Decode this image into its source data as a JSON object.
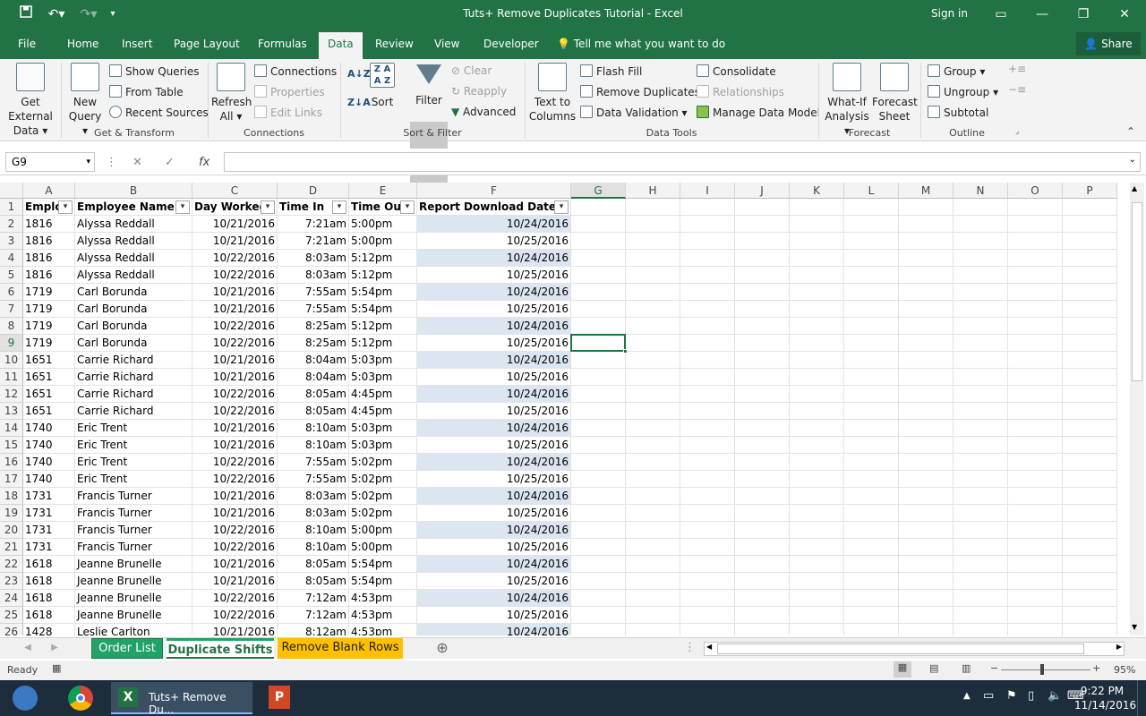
{
  "window": {
    "title": "Tuts+ Remove Duplicates Tutorial  -  Excel",
    "sign_in": "Sign in"
  },
  "tabs": [
    "File",
    "Home",
    "Insert",
    "Page Layout",
    "Formulas",
    "Data",
    "Review",
    "View",
    "Developer"
  ],
  "tell_me": "Tell me what you want to do",
  "share": "Share",
  "ribbon": {
    "get_external": [
      "Get External",
      "Data"
    ],
    "new_query": [
      "New",
      "Query"
    ],
    "show_queries": "Show Queries",
    "from_table": "From Table",
    "recent_sources": "Recent Sources",
    "group_get_transform": "Get & Transform",
    "refresh_all": [
      "Refresh",
      "All"
    ],
    "connections": "Connections",
    "properties": "Properties",
    "edit_links": "Edit Links",
    "group_connections": "Connections",
    "sort": "Sort",
    "filter": "Filter",
    "clear": "Clear",
    "reapply": "Reapply",
    "advanced": "Advanced",
    "group_sort_filter": "Sort & Filter",
    "text_to_columns": [
      "Text to",
      "Columns"
    ],
    "flash_fill": "Flash Fill",
    "remove_duplicates": "Remove Duplicates",
    "data_validation": "Data Validation",
    "consolidate": "Consolidate",
    "relationships": "Relationships",
    "manage_data_model": "Manage Data Model",
    "group_data_tools": "Data Tools",
    "what_if": [
      "What-If",
      "Analysis"
    ],
    "forecast_sheet": [
      "Forecast",
      "Sheet"
    ],
    "group_forecast": "Forecast",
    "group": "Group",
    "ungroup": "Ungroup",
    "subtotal": "Subtotal",
    "group_outline": "Outline"
  },
  "name_box": "G9",
  "columns": [
    "A",
    "B",
    "C",
    "D",
    "E",
    "F",
    "G",
    "H",
    "I",
    "J",
    "K",
    "L",
    "M",
    "N",
    "O",
    "P"
  ],
  "headers": [
    "Emplo",
    "Employee Name",
    "Day Worked",
    "Time In",
    "Time Out",
    "Report Download Date"
  ],
  "rows": [
    [
      "1816",
      "Alyssa Reddall",
      "10/21/2016",
      "7:21am",
      "5:00pm",
      "10/24/2016"
    ],
    [
      "1816",
      "Alyssa Reddall",
      "10/21/2016",
      "7:21am",
      "5:00pm",
      "10/25/2016"
    ],
    [
      "1816",
      "Alyssa Reddall",
      "10/22/2016",
      "8:03am",
      "5:12pm",
      "10/24/2016"
    ],
    [
      "1816",
      "Alyssa Reddall",
      "10/22/2016",
      "8:03am",
      "5:12pm",
      "10/25/2016"
    ],
    [
      "1719",
      "Carl Borunda",
      "10/21/2016",
      "7:55am",
      "5:54pm",
      "10/24/2016"
    ],
    [
      "1719",
      "Carl Borunda",
      "10/21/2016",
      "7:55am",
      "5:54pm",
      "10/25/2016"
    ],
    [
      "1719",
      "Carl Borunda",
      "10/22/2016",
      "8:25am",
      "5:12pm",
      "10/24/2016"
    ],
    [
      "1719",
      "Carl Borunda",
      "10/22/2016",
      "8:25am",
      "5:12pm",
      "10/25/2016"
    ],
    [
      "1651",
      "Carrie Richard",
      "10/21/2016",
      "8:04am",
      "5:03pm",
      "10/24/2016"
    ],
    [
      "1651",
      "Carrie Richard",
      "10/21/2016",
      "8:04am",
      "5:03pm",
      "10/25/2016"
    ],
    [
      "1651",
      "Carrie Richard",
      "10/22/2016",
      "8:05am",
      "4:45pm",
      "10/24/2016"
    ],
    [
      "1651",
      "Carrie Richard",
      "10/22/2016",
      "8:05am",
      "4:45pm",
      "10/25/2016"
    ],
    [
      "1740",
      "Eric Trent",
      "10/21/2016",
      "8:10am",
      "5:03pm",
      "10/24/2016"
    ],
    [
      "1740",
      "Eric Trent",
      "10/21/2016",
      "8:10am",
      "5:03pm",
      "10/25/2016"
    ],
    [
      "1740",
      "Eric Trent",
      "10/22/2016",
      "7:55am",
      "5:02pm",
      "10/24/2016"
    ],
    [
      "1740",
      "Eric Trent",
      "10/22/2016",
      "7:55am",
      "5:02pm",
      "10/25/2016"
    ],
    [
      "1731",
      "Francis Turner",
      "10/21/2016",
      "8:03am",
      "5:02pm",
      "10/24/2016"
    ],
    [
      "1731",
      "Francis Turner",
      "10/21/2016",
      "8:03am",
      "5:02pm",
      "10/25/2016"
    ],
    [
      "1731",
      "Francis Turner",
      "10/22/2016",
      "8:10am",
      "5:00pm",
      "10/24/2016"
    ],
    [
      "1731",
      "Francis Turner",
      "10/22/2016",
      "8:10am",
      "5:00pm",
      "10/25/2016"
    ],
    [
      "1618",
      "Jeanne Brunelle",
      "10/21/2016",
      "8:05am",
      "5:54pm",
      "10/24/2016"
    ],
    [
      "1618",
      "Jeanne Brunelle",
      "10/21/2016",
      "8:05am",
      "5:54pm",
      "10/25/2016"
    ],
    [
      "1618",
      "Jeanne Brunelle",
      "10/22/2016",
      "7:12am",
      "4:53pm",
      "10/24/2016"
    ],
    [
      "1618",
      "Jeanne Brunelle",
      "10/22/2016",
      "7:12am",
      "4:53pm",
      "10/25/2016"
    ],
    [
      "1428",
      "Leslie Carlton",
      "10/21/2016",
      "8:12am",
      "4:53pm",
      "10/24/2016"
    ]
  ],
  "sheets": [
    "Order List",
    "Duplicate Shifts",
    "Remove Blank Rows"
  ],
  "active_sheet": "Duplicate Shifts",
  "status": {
    "ready": "Ready",
    "zoom": "95%"
  },
  "taskbar": {
    "excel_label": "Tuts+ Remove Du...",
    "time": "9:22 PM",
    "date": "11/14/2016"
  },
  "colors": {
    "excel_green": "#217346",
    "blue_band": "#dce6f1"
  }
}
